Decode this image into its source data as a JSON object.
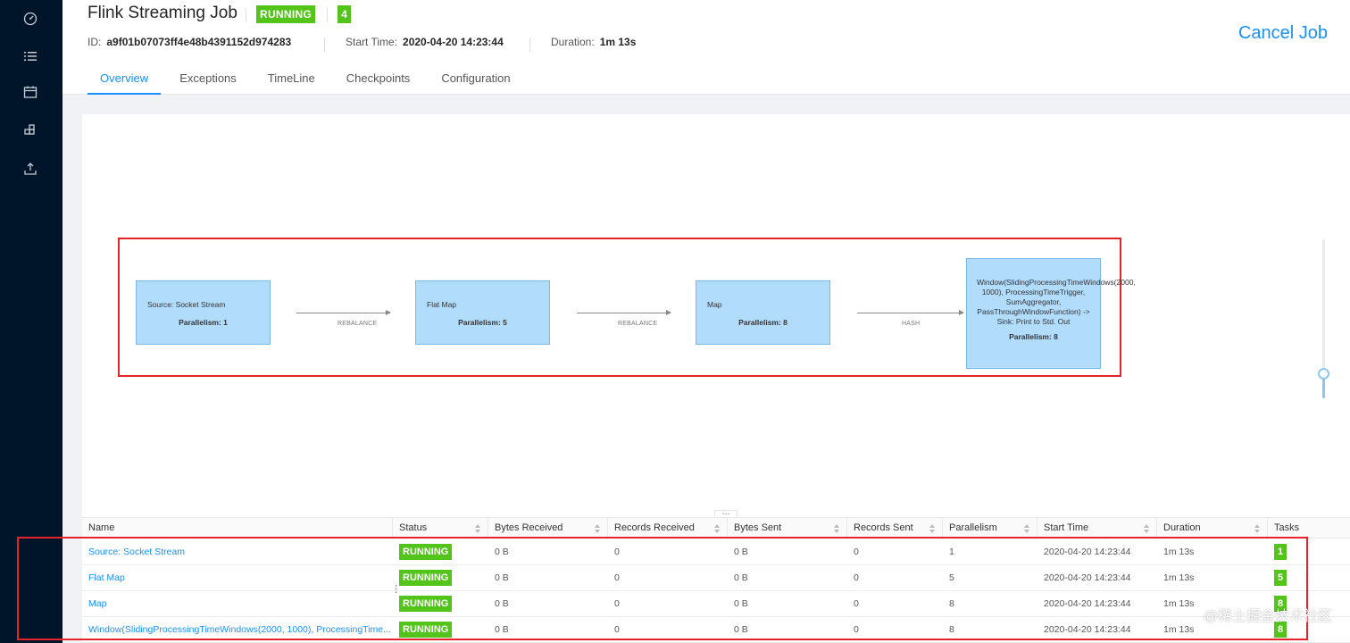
{
  "sidebar": {
    "icons": [
      "dashboard-icon",
      "list-icon",
      "calendar-icon",
      "cluster-icon",
      "upload-icon"
    ]
  },
  "header": {
    "title": "Flink Streaming Job",
    "status": "RUNNING",
    "task_count": "4",
    "id_label": "ID:",
    "id_value": "a9f01b07073ff4e48b4391152d974283",
    "start_label": "Start Time:",
    "start_value": "2020-04-20 14:23:44",
    "duration_label": "Duration:",
    "duration_value": "1m 13s",
    "cancel_label": "Cancel Job"
  },
  "tabs": [
    {
      "label": "Overview",
      "active": true
    },
    {
      "label": "Exceptions",
      "active": false
    },
    {
      "label": "TimeLine",
      "active": false
    },
    {
      "label": "Checkpoints",
      "active": false
    },
    {
      "label": "Configuration",
      "active": false
    }
  ],
  "graph": {
    "nodes": [
      {
        "name": "Source: Socket Stream",
        "parallelism": "Parallelism: 1"
      },
      {
        "name": "Flat Map",
        "parallelism": "Parallelism: 5"
      },
      {
        "name": "Map",
        "parallelism": "Parallelism: 8"
      },
      {
        "name": "Window(SlidingProcessingTimeWindows(2000, 1000), ProcessingTimeTrigger, SumAggregator, PassThroughWindowFunction) -> Sink: Print to Std. Out",
        "parallelism": "Parallelism: 8"
      }
    ],
    "edges": [
      "REBALANCE",
      "REBALANCE",
      "HASH"
    ]
  },
  "table": {
    "columns": [
      "Name",
      "Status",
      "Bytes Received",
      "Records Received",
      "Bytes Sent",
      "Records Sent",
      "Parallelism",
      "Start Time",
      "Duration",
      "Tasks"
    ],
    "rows": [
      {
        "name": "Source: Socket Stream",
        "status": "RUNNING",
        "bytes_received": "0 B",
        "records_received": "0",
        "bytes_sent": "0 B",
        "records_sent": "0",
        "parallelism": "1",
        "start_time": "2020-04-20 14:23:44",
        "duration": "1m 13s",
        "tasks": "1"
      },
      {
        "name": "Flat Map",
        "status": "RUNNING",
        "bytes_received": "0 B",
        "records_received": "0",
        "bytes_sent": "0 B",
        "records_sent": "0",
        "parallelism": "5",
        "start_time": "2020-04-20 14:23:44",
        "duration": "1m 13s",
        "tasks": "5"
      },
      {
        "name": "Map",
        "status": "RUNNING",
        "bytes_received": "0 B",
        "records_received": "0",
        "bytes_sent": "0 B",
        "records_sent": "0",
        "parallelism": "8",
        "start_time": "2020-04-20 14:23:44",
        "duration": "1m 13s",
        "tasks": "8"
      },
      {
        "name": "Window(SlidingProcessingTimeWindows(2000, 1000), ProcessingTime...",
        "status": "RUNNING",
        "bytes_received": "0 B",
        "records_received": "0",
        "bytes_sent": "0 B",
        "records_sent": "0",
        "parallelism": "8",
        "start_time": "2020-04-20 14:23:44",
        "duration": "1m 13s",
        "tasks": "8"
      }
    ]
  },
  "watermark": "@稀土掘金技术社区",
  "colors": {
    "accent": "#1890ff",
    "running": "#52c41a",
    "sidebar": "#001529",
    "highlight": "#e8222b",
    "node_fill": "#b2dcfc"
  }
}
